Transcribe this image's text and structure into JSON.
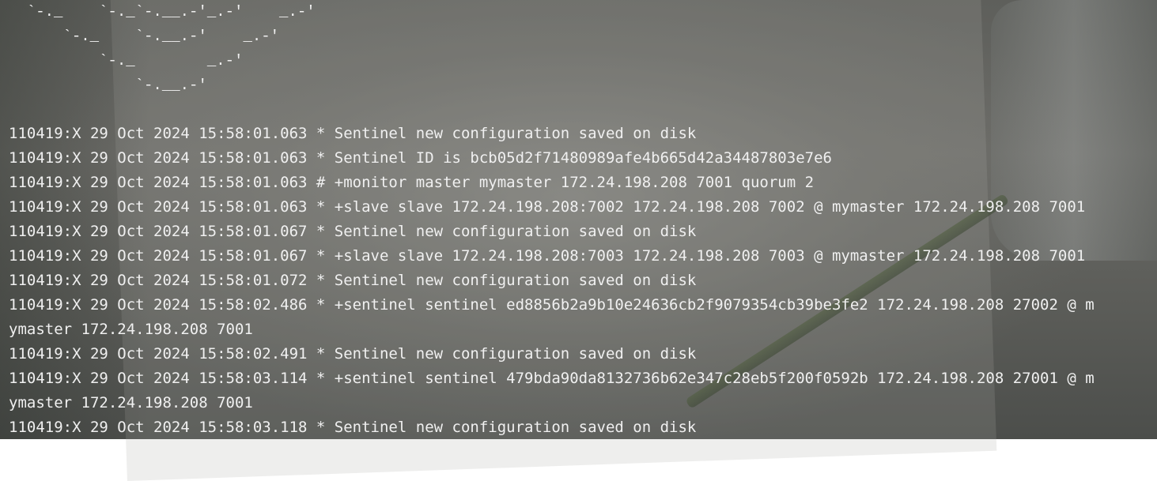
{
  "ascii_art": [
    "  `-._    `-._`-.__.-'_.-'    _.-'",
    "      `-._    `-.__.-'    _.-'",
    "          `-._        _.-'",
    "              `-.__.-'"
  ],
  "log_lines": [
    "110419:X 29 Oct 2024 15:58:01.063 * Sentinel new configuration saved on disk",
    "110419:X 29 Oct 2024 15:58:01.063 * Sentinel ID is bcb05d2f71480989afe4b665d42a34487803e7e6",
    "110419:X 29 Oct 2024 15:58:01.063 # +monitor master mymaster 172.24.198.208 7001 quorum 2",
    "110419:X 29 Oct 2024 15:58:01.063 * +slave slave 172.24.198.208:7002 172.24.198.208 7002 @ mymaster 172.24.198.208 7001",
    "110419:X 29 Oct 2024 15:58:01.067 * Sentinel new configuration saved on disk",
    "110419:X 29 Oct 2024 15:58:01.067 * +slave slave 172.24.198.208:7003 172.24.198.208 7003 @ mymaster 172.24.198.208 7001",
    "110419:X 29 Oct 2024 15:58:01.072 * Sentinel new configuration saved on disk",
    "110419:X 29 Oct 2024 15:58:02.486 * +sentinel sentinel ed8856b2a9b10e24636cb2f9079354cb39be3fe2 172.24.198.208 27002 @ m",
    "ymaster 172.24.198.208 7001",
    "110419:X 29 Oct 2024 15:58:02.491 * Sentinel new configuration saved on disk",
    "110419:X 29 Oct 2024 15:58:03.114 * +sentinel sentinel 479bda90da8132736b62e347c28eb5f200f0592b 172.24.198.208 27001 @ m",
    "ymaster 172.24.198.208 7001",
    "110419:X 29 Oct 2024 15:58:03.118 * Sentinel new configuration saved on disk"
  ]
}
